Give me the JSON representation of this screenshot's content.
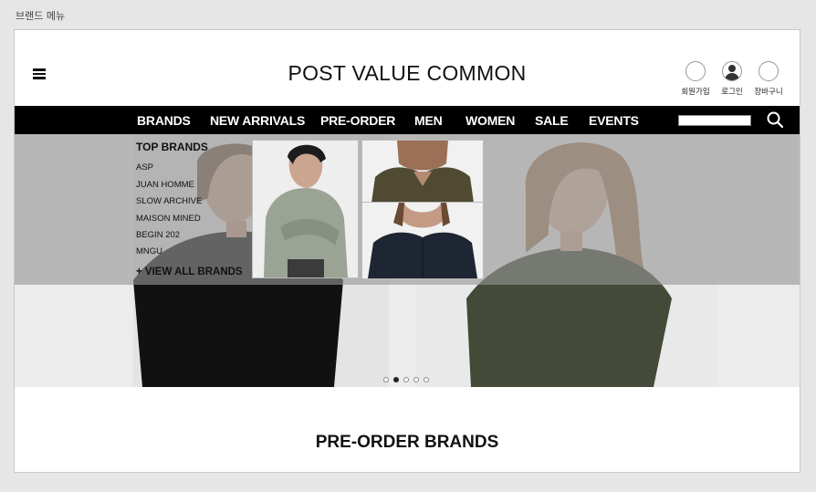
{
  "page_label": "브랜드 메뉴",
  "header": {
    "logo": "POST VALUE COMMON",
    "utils": [
      {
        "label": "회원가입",
        "icon": "signup-icon"
      },
      {
        "label": "로그인",
        "icon": "user-icon"
      },
      {
        "label": "장바구니",
        "icon": "cart-icon"
      }
    ]
  },
  "nav": {
    "items": [
      "BRANDS",
      "NEW ARRIVALS",
      "PRE-ORDER",
      "MEN",
      "WOMEN",
      "SALE",
      "EVENTS"
    ],
    "search_icon": "search-icon"
  },
  "dropdown": {
    "title": "TOP BRANDS",
    "brands": [
      "ASP",
      "JUAN HOMME",
      "SLOW ARCHIVE",
      "MAISON MINED",
      "BEGIN 202",
      "MNGU"
    ],
    "view_all": "+ VIEW ALL BRANDS"
  },
  "carousel": {
    "slide_count": 5,
    "active_index": 1
  },
  "section": {
    "title": "PRE-ORDER BRANDS"
  },
  "colors": {
    "nav_bg": "#000000",
    "nav_text": "#ffffff",
    "overlay": "#969696"
  }
}
